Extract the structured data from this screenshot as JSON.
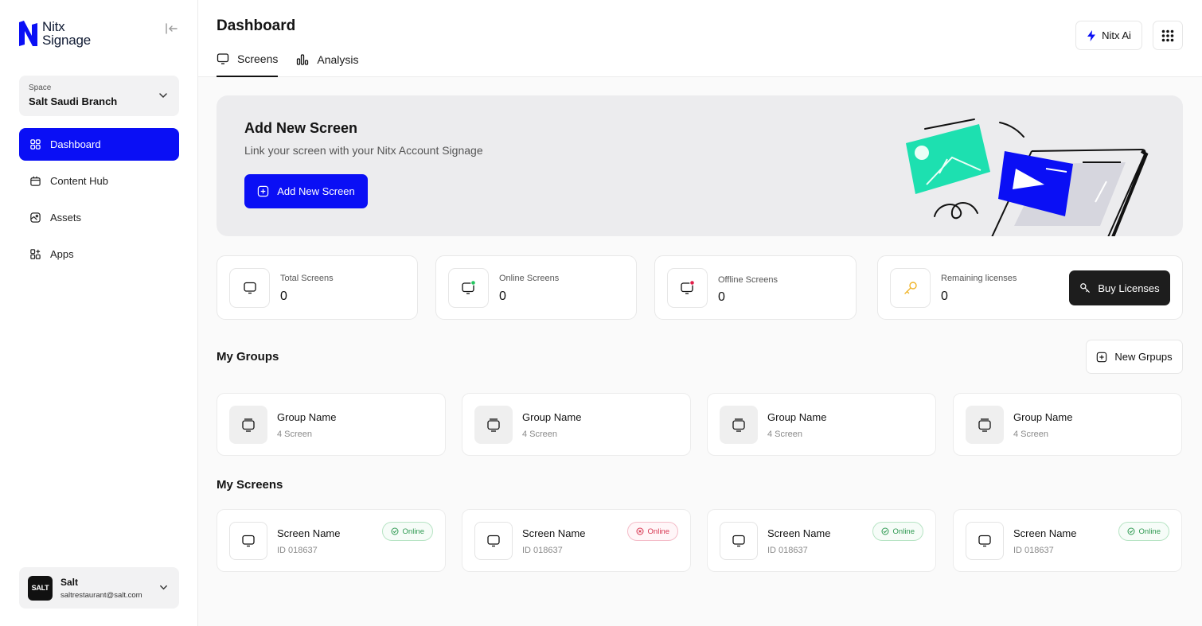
{
  "brand": {
    "line1": "Nitx",
    "line2": "Signage",
    "color": "#0A0FF5"
  },
  "space": {
    "label": "Space",
    "value": "Salt Saudi Branch"
  },
  "nav": [
    {
      "label": "Dashboard",
      "icon": "dashboard-icon",
      "active": true
    },
    {
      "label": "Content Hub",
      "icon": "content-hub-icon"
    },
    {
      "label": "Assets",
      "icon": "assets-icon"
    },
    {
      "label": "Apps",
      "icon": "apps-icon"
    }
  ],
  "user": {
    "avatar_text": "SALT",
    "name": "Salt",
    "email": "saltrestaurant@salt.com"
  },
  "header": {
    "title": "Dashboard",
    "tabs": [
      {
        "label": "Screens",
        "active": true
      },
      {
        "label": "Analysis"
      }
    ],
    "ai_button": "Nitx Ai"
  },
  "hero": {
    "title": "Add New Screen",
    "subtitle": "Link your screen with your Nitx  Account Signage",
    "button": "Add New Screen"
  },
  "stats": [
    {
      "label": "Total Screens",
      "value": "0"
    },
    {
      "label": "Online Screens",
      "value": "0",
      "status_color": "#22C55E"
    },
    {
      "label": "Offline Screens",
      "value": "0",
      "status_color": "#E11D48"
    },
    {
      "label": "Remaining licenses",
      "value": "0",
      "button": "Buy Licenses"
    }
  ],
  "groups": {
    "title": "My Groups",
    "new_button": "New Grpups",
    "items": [
      {
        "name": "Group Name",
        "count": "4 Screen"
      },
      {
        "name": "Group Name",
        "count": "4 Screen"
      },
      {
        "name": "Group Name",
        "count": "4 Screen"
      },
      {
        "name": "Group Name",
        "count": "4 Screen"
      }
    ]
  },
  "screens": {
    "title": "My Screens",
    "items": [
      {
        "name": "Screen Name",
        "id": "ID 018637",
        "status": "Online",
        "state": "ok"
      },
      {
        "name": "Screen Name",
        "id": "ID 018637",
        "status": "Online",
        "state": "err"
      },
      {
        "name": "Screen Name",
        "id": "ID 018637",
        "status": "Online",
        "state": "ok"
      },
      {
        "name": "Screen Name",
        "id": "ID 018637",
        "status": "Online",
        "state": "ok"
      }
    ]
  },
  "colors": {
    "primary": "#0A0FF5",
    "online": "#2F9A52",
    "offline": "#D7344F",
    "illustration_teal": "#1DE0B0"
  }
}
